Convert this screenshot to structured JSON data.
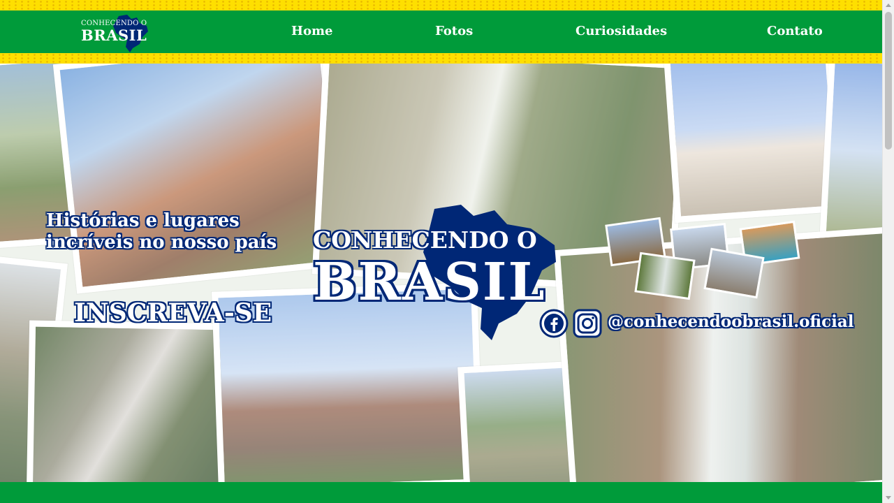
{
  "header": {
    "logo_line1": "CONHECENDO O",
    "logo_line2": "BRASIL",
    "nav": [
      {
        "label": "Home"
      },
      {
        "label": "Fotos"
      },
      {
        "label": "Curiosidades"
      },
      {
        "label": "Contato"
      }
    ]
  },
  "hero": {
    "tagline_line1": "Histórias e lugares",
    "tagline_line2": "incríveis no nosso país",
    "cta_label": "INSCREVA-SE",
    "brand_line1": "CONHECENDO O",
    "brand_line2": "BRASIL",
    "social_handle": "@conhecendoobrasil.oficial"
  },
  "icons": {
    "facebook": "facebook-icon",
    "instagram": "instagram-icon",
    "map": "brazil-map-icon"
  },
  "colors": {
    "green": "#009b3a",
    "yellow": "#fedf00",
    "blue": "#002776",
    "white": "#ffffff"
  }
}
